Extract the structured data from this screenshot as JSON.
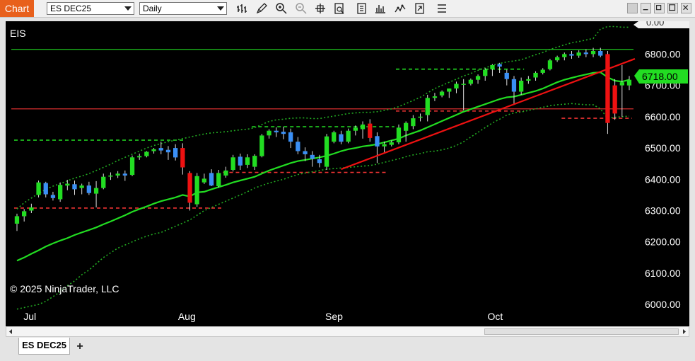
{
  "window": {
    "title": "Chart"
  },
  "toolbar": {
    "instrument": "ES DEC25",
    "interval": "Daily",
    "buttons": [
      "bar-type-icon",
      "draw-pencil-icon",
      "zoom-in-icon",
      "zoom-out-icon",
      "crosshair-icon",
      "data-box-icon",
      "properties-icon",
      "strategies-icon",
      "indicators-icon",
      "share-icon",
      "menu-icon"
    ]
  },
  "chart": {
    "symbol": "EIS",
    "copyright": "© 2025 NinjaTrader, LLC",
    "last_price": "6718.00",
    "top_price_label": "0.00",
    "y_ticks": [
      "6800.00",
      "6700.00",
      "6600.00",
      "6500.00",
      "6400.00",
      "6300.00",
      "6200.00",
      "6100.00",
      "6000.00"
    ],
    "x_ticks": [
      "Jul",
      "Aug",
      "Sep",
      "Oct"
    ],
    "colors": {
      "background": "#000000",
      "up_candle": "#22dd22",
      "down_candle_trend": "#3a8ff5",
      "down_candle_strong": "#ee1111",
      "sma": "#22dd22",
      "bollinger": "#22aa22",
      "trendline": "#ee1111",
      "horizontal_green": "#22dd22",
      "horizontal_red": "#ee3333",
      "price_marker": "#22dd22"
    }
  },
  "chart_data": {
    "type": "candlestick",
    "title": "EIS",
    "y_range": [
      5955,
      6905
    ],
    "ohlc": [
      [
        "Jun 30",
        6258,
        6290,
        6235,
        6282
      ],
      [
        "Jul 1",
        6282,
        6305,
        6265,
        6298
      ],
      [
        "Jul 2",
        6300,
        6322,
        6292,
        6310
      ],
      [
        "Jul 3",
        6350,
        6396,
        6342,
        6390
      ],
      [
        "Jul 7",
        6388,
        6392,
        6342,
        6352
      ],
      [
        "Jul 8",
        6350,
        6360,
        6332,
        6340
      ],
      [
        "Jul 9",
        6336,
        6390,
        6328,
        6382
      ],
      [
        "Jul 10",
        6380,
        6398,
        6365,
        6386
      ],
      [
        "Jul 11",
        6384,
        6396,
        6350,
        6368
      ],
      [
        "Jul 14",
        6372,
        6386,
        6352,
        6380
      ],
      [
        "Jul 15",
        6380,
        6392,
        6350,
        6356
      ],
      [
        "Jul 16",
        6354,
        6394,
        6310,
        6372
      ],
      [
        "Jul 17",
        6372,
        6418,
        6368,
        6408
      ],
      [
        "Jul 18",
        6410,
        6422,
        6398,
        6412
      ],
      [
        "Jul 21",
        6412,
        6426,
        6404,
        6418
      ],
      [
        "Jul 22",
        6418,
        6428,
        6395,
        6412
      ],
      [
        "Jul 23",
        6414,
        6476,
        6410,
        6470
      ],
      [
        "Jul 24",
        6470,
        6482,
        6462,
        6474
      ],
      [
        "Jul 25",
        6474,
        6490,
        6470,
        6488
      ],
      [
        "Jul 28",
        6490,
        6500,
        6482,
        6496
      ],
      [
        "Jul 29",
        6500,
        6520,
        6480,
        6492
      ],
      [
        "Jul 30",
        6494,
        6506,
        6462,
        6486
      ],
      [
        "Jul 31",
        6500,
        6512,
        6460,
        6470
      ],
      [
        "Aug 1",
        6500,
        6515,
        6415,
        6438
      ],
      [
        "Aug 4",
        6420,
        6426,
        6300,
        6325
      ],
      [
        "Aug 5",
        6320,
        6420,
        6312,
        6410
      ],
      [
        "Aug 6",
        6390,
        6418,
        6385,
        6402
      ],
      [
        "Aug 7",
        6420,
        6432,
        6378,
        6380
      ],
      [
        "Aug 8",
        6378,
        6430,
        6374,
        6420
      ],
      [
        "Aug 11",
        6412,
        6440,
        6405,
        6428
      ],
      [
        "Aug 12",
        6430,
        6478,
        6425,
        6470
      ],
      [
        "Aug 13",
        6472,
        6482,
        6430,
        6444
      ],
      [
        "Aug 14",
        6446,
        6480,
        6436,
        6470
      ],
      [
        "Aug 15",
        6440,
        6480,
        6430,
        6475
      ],
      [
        "Aug 18",
        6474,
        6545,
        6470,
        6540
      ],
      [
        "Aug 19",
        6540,
        6560,
        6530,
        6555
      ],
      [
        "Aug 20",
        6555,
        6566,
        6535,
        6550
      ],
      [
        "Aug 21",
        6552,
        6568,
        6528,
        6545
      ],
      [
        "Aug 22",
        6550,
        6562,
        6500,
        6520
      ],
      [
        "Aug 25",
        6520,
        6535,
        6480,
        6490
      ],
      [
        "Aug 26",
        6490,
        6502,
        6458,
        6480
      ],
      [
        "Aug 27",
        6478,
        6490,
        6440,
        6465
      ],
      [
        "Aug 28",
        6464,
        6478,
        6438,
        6452
      ],
      [
        "Aug 29",
        6440,
        6545,
        6430,
        6537
      ],
      [
        "Aug 2x",
        6520,
        6555,
        6515,
        6550
      ],
      [
        "Sep 2",
        6544,
        6555,
        6512,
        6520
      ],
      [
        "Sep 3",
        6520,
        6562,
        6515,
        6555
      ],
      [
        "Sep 4",
        6555,
        6572,
        6540,
        6565
      ],
      [
        "Sep 5",
        6560,
        6585,
        6530,
        6575
      ],
      [
        "Sep 8",
        6578,
        6592,
        6520,
        6532
      ],
      [
        "Sep 9",
        6538,
        6550,
        6452,
        6505
      ],
      [
        "Sep 10",
        6505,
        6520,
        6485,
        6512
      ],
      [
        "Sep 11",
        6510,
        6524,
        6505,
        6518
      ],
      [
        "Sep 12",
        6518,
        6575,
        6512,
        6565
      ],
      [
        "Sep 15",
        6555,
        6585,
        6520,
        6580
      ],
      [
        "Sep 16",
        6570,
        6605,
        6560,
        6595
      ],
      [
        "Sep 17",
        6600,
        6610,
        6585,
        6600
      ],
      [
        "Sep 18",
        6605,
        6670,
        6585,
        6660
      ],
      [
        "Sep 19",
        6660,
        6676,
        6650,
        6665
      ],
      [
        "Sep 22",
        6668,
        6684,
        6662,
        6680
      ],
      [
        "Sep 23",
        6680,
        6690,
        6660,
        6690
      ],
      [
        "Sep 24",
        6690,
        6712,
        6675,
        6705
      ],
      [
        "Sep 25",
        6705,
        6720,
        6620,
        6705
      ],
      [
        "Sep 26",
        6705,
        6722,
        6700,
        6718
      ],
      [
        "Sep 29",
        6718,
        6735,
        6705,
        6730
      ],
      [
        "Sep 30",
        6730,
        6755,
        6715,
        6750
      ],
      [
        "Oct 1",
        6752,
        6768,
        6730,
        6765
      ],
      [
        "Oct 2",
        6768,
        6772,
        6740,
        6760
      ],
      [
        "Oct 3",
        6740,
        6750,
        6700,
        6720
      ],
      [
        "Oct 6",
        6720,
        6730,
        6640,
        6680
      ],
      [
        "Oct 7",
        6680,
        6725,
        6670,
        6715
      ],
      [
        "Oct 8",
        6715,
        6730,
        6705,
        6720
      ],
      [
        "Oct 9",
        6725,
        6745,
        6715,
        6740
      ],
      [
        "Oct 10",
        6740,
        6755,
        6735,
        6750
      ],
      [
        "Oct 13",
        6752,
        6785,
        6748,
        6780
      ],
      [
        "Oct 14",
        6780,
        6795,
        6775,
        6790
      ],
      [
        "Oct 15",
        6790,
        6805,
        6780,
        6800
      ],
      [
        "Oct 16",
        6800,
        6810,
        6785,
        6795
      ],
      [
        "Oct 17",
        6795,
        6812,
        6788,
        6805
      ],
      [
        "Oct 20",
        6805,
        6815,
        6790,
        6800
      ],
      [
        "Oct 21",
        6800,
        6820,
        6790,
        6810
      ],
      [
        "Oct 22",
        6810,
        6820,
        6790,
        6795
      ],
      [
        "Oct 23",
        6800,
        6810,
        6545,
        6580
      ],
      [
        "Oct 24",
        6700,
        6720,
        6590,
        6610
      ],
      [
        "Oct 27",
        6700,
        6765,
        6600,
        6710
      ],
      [
        "Oct 28",
        6700,
        6730,
        6685,
        6718
      ]
    ],
    "sma": [
      6140,
      6150,
      6162,
      6173,
      6185,
      6195,
      6204,
      6212,
      6222,
      6230,
      6238,
      6246,
      6256,
      6265,
      6275,
      6285,
      6296,
      6305,
      6313,
      6322,
      6330,
      6336,
      6342,
      6350,
      6345,
      6358,
      6360,
      6368,
      6375,
      6382,
      6390,
      6396,
      6402,
      6408,
      6418,
      6428,
      6436,
      6444,
      6452,
      6458,
      6462,
      6466,
      6470,
      6475,
      6482,
      6490,
      6496,
      6500,
      6505,
      6508,
      6512,
      6518,
      6524,
      6530,
      6540,
      6548,
      6556,
      6566,
      6576,
      6586,
      6596,
      6606,
      6616,
      6624,
      6632,
      6640,
      6648,
      6656,
      6662,
      6664,
      6670,
      6676,
      6682,
      6690,
      6700,
      6710,
      6718,
      6724,
      6730,
      6735,
      6740,
      6742,
      6726,
      6715,
      6712,
      6718
    ],
    "bb_upper": [
      6305,
      6325,
      6340,
      6355,
      6368,
      6378,
      6386,
      6395,
      6404,
      6410,
      6418,
      6428,
      6438,
      6448,
      6460,
      6470,
      6480,
      6490,
      6500,
      6508,
      6514,
      6520,
      6525,
      6530,
      6535,
      6540,
      6545,
      6548,
      6550,
      6552,
      6555,
      6558,
      6560,
      6565,
      6575,
      6585,
      6590,
      6592,
      6595,
      6596,
      6596,
      6594,
      6594,
      6598,
      6602,
      6606,
      6610,
      6612,
      6614,
      6614,
      6616,
      6620,
      6625,
      6632,
      6642,
      6652,
      6662,
      6676,
      6690,
      6700,
      6710,
      6720,
      6730,
      6738,
      6748,
      6756,
      6764,
      6770,
      6775,
      6778,
      6782,
      6790,
      6798,
      6805,
      6815,
      6822,
      6830,
      6836,
      6840,
      6845,
      6850,
      6880,
      6888,
      6888,
      6886,
      6886
    ],
    "bb_lower": [
      5985,
      5990,
      5995,
      6000,
      6010,
      6025,
      6040,
      6060,
      6075,
      6095,
      6110,
      6130,
      6150,
      6165,
      6180,
      6190,
      6200,
      6210,
      6218,
      6225,
      6230,
      6240,
      6250,
      6260,
      6270,
      6285,
      6300,
      6310,
      6320,
      6330,
      6340,
      6350,
      6360,
      6372,
      6380,
      6388,
      6394,
      6400,
      6408,
      6415,
      6420,
      6424,
      6428,
      6432,
      6434,
      6436,
      6438,
      6440,
      6442,
      6444,
      6448,
      6454,
      6460,
      6465,
      6472,
      6478,
      6482,
      6488,
      6490,
      6494,
      6500,
      6508,
      6520,
      6535,
      6550,
      6565,
      6580,
      6592,
      6605,
      6612,
      6615,
      6620,
      6625,
      6630,
      6635,
      6638,
      6640,
      6642,
      6640,
      6638,
      6638,
      6625,
      6595,
      6598,
      6600,
      6602
    ],
    "horizontal_lines": [
      {
        "price": 6815,
        "style": "solid",
        "color": "green"
      },
      {
        "price": 6625,
        "style": "solid",
        "color": "red"
      }
    ],
    "dashed_levels": [
      {
        "price": 6525,
        "style": "dashed",
        "color": "green",
        "from": "Jun 30",
        "to": "Aug 1"
      },
      {
        "price": 6308,
        "style": "dashed",
        "color": "red",
        "from": "Jun 30",
        "to": "Aug 8"
      },
      {
        "price": 6568,
        "style": "dashed",
        "color": "green",
        "from": "Aug 15",
        "to": "Sep 11"
      },
      {
        "price": 6422,
        "style": "dashed",
        "color": "red",
        "from": "Aug 11",
        "to": "Sep 10"
      },
      {
        "price": 6752,
        "style": "dashed",
        "color": "green",
        "from": "Sep 12",
        "to": "Oct 7"
      },
      {
        "price": 6618,
        "style": "dashed",
        "color": "red",
        "from": "Sep 12",
        "to": "Oct 7"
      },
      {
        "price": 6595,
        "style": "dashed",
        "color": "red",
        "from": "Oct 15",
        "to": "Oct 28"
      }
    ],
    "trendline": {
      "from": [
        "Sep 2",
        6432
      ],
      "to": [
        "Oct 28",
        6785
      ]
    }
  }
}
